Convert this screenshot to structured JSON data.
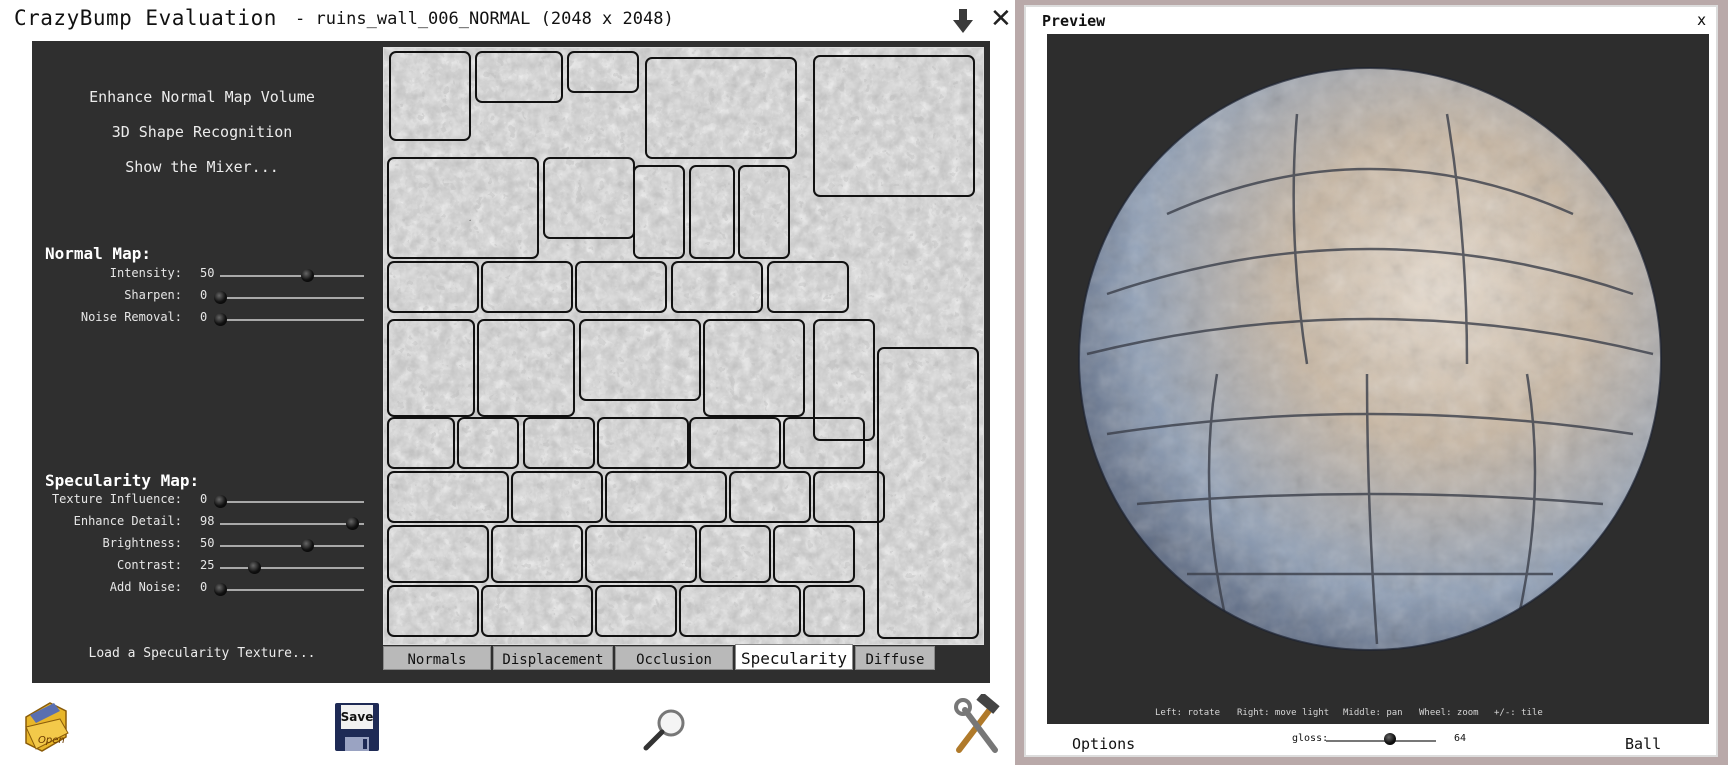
{
  "main": {
    "title": "CrazyBump Evaluation",
    "file_info": "- ruins_wall_006_NORMAL (2048 x 2048)"
  },
  "menu": {
    "enhance": "Enhance Normal Map Volume",
    "recognition": "3D Shape Recognition",
    "mixer": "Show the Mixer..."
  },
  "normal_map": {
    "heading": "Normal Map:",
    "sliders": [
      {
        "label": "Intensity:",
        "value": "50",
        "level": 0.64
      },
      {
        "label": "Sharpen:",
        "value": "0",
        "level": 0.0
      },
      {
        "label": "Noise Removal:",
        "value": "0",
        "level": 0.0
      }
    ]
  },
  "specularity_map": {
    "heading": "Specularity Map:",
    "sliders": [
      {
        "label": "Texture Influence:",
        "value": "0",
        "level": 0.0
      },
      {
        "label": "Enhance Detail:",
        "value": "98",
        "level": 0.97
      },
      {
        "label": "Brightness:",
        "value": "50",
        "level": 0.64
      },
      {
        "label": "Contrast:",
        "value": "25",
        "level": 0.25
      },
      {
        "label": "Add Noise:",
        "value": "0",
        "level": 0.0
      }
    ],
    "load_link": "Load a Specularity Texture..."
  },
  "tabs": [
    {
      "label": "Normals",
      "active": false
    },
    {
      "label": "Displacement",
      "active": false
    },
    {
      "label": "Occlusion",
      "active": false
    },
    {
      "label": "Specularity",
      "active": true
    },
    {
      "label": "Diffuse",
      "active": false
    }
  ],
  "toolbar": {
    "open_label": "Open",
    "save_label": "Save"
  },
  "preview": {
    "title": "Preview",
    "close": "x",
    "hints": [
      "Left: rotate",
      "Right: move light",
      "Middle: pan",
      "Wheel: zoom",
      "+/-: tile"
    ],
    "options_label": "Options",
    "ball_label": "Ball",
    "gloss_label": "gloss:",
    "gloss_value": "64",
    "gloss_level": 0.58
  },
  "colors": {
    "panel_bg": "#2f2f2f",
    "viewport_bg": "#2d2d2d",
    "tab_inactive": "#b9b9b9",
    "tab_active": "#ffffff"
  }
}
